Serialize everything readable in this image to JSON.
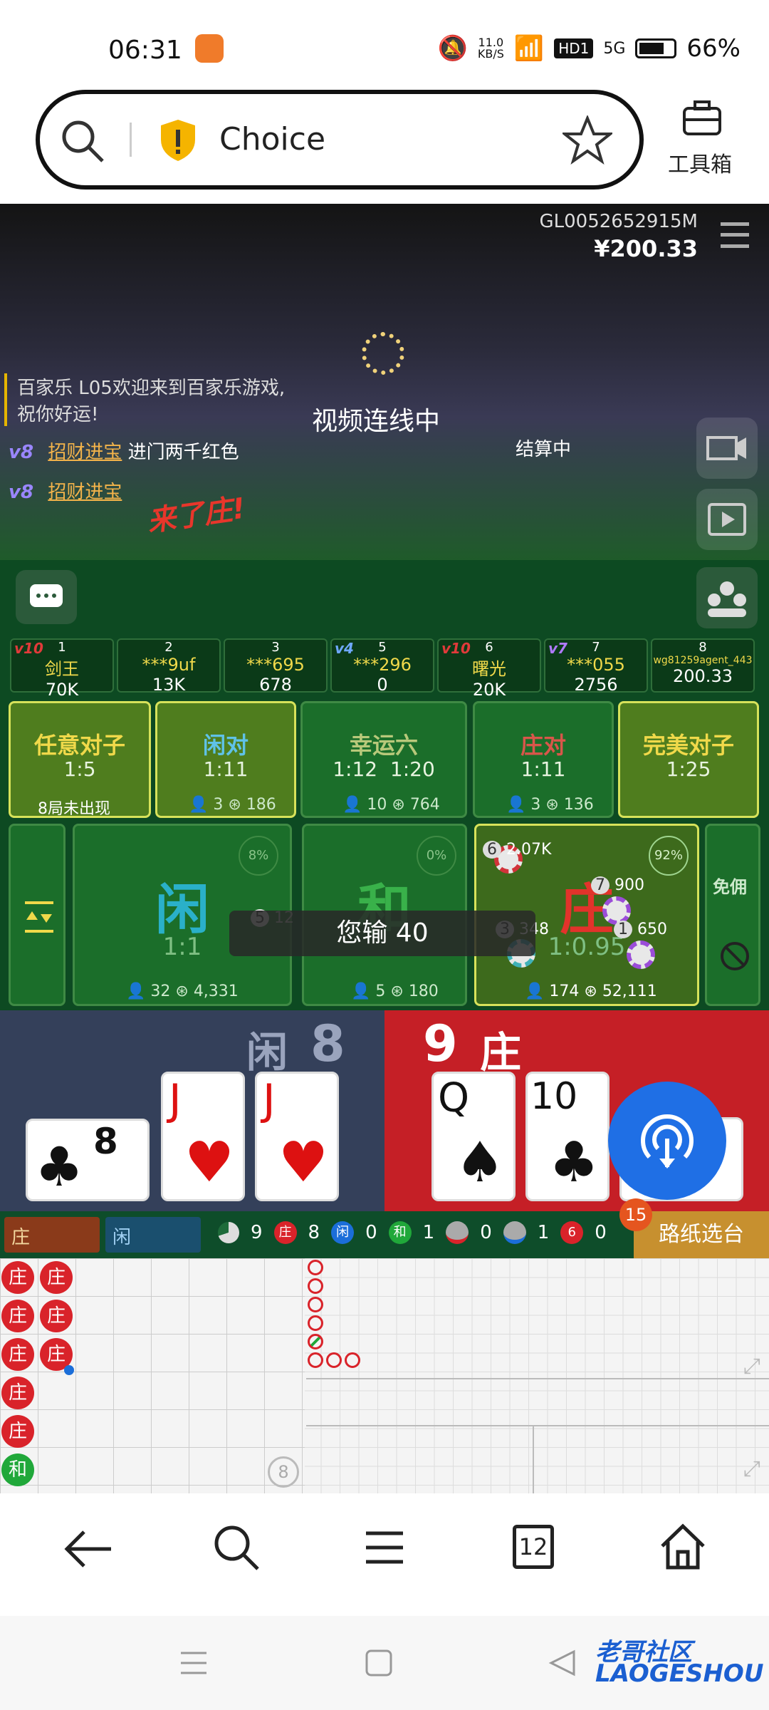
{
  "status": {
    "time": "06:31",
    "speed": "11.0\nKB/S",
    "hd": "HD1",
    "net": "5G",
    "battery": "66%"
  },
  "browser": {
    "site_name": "Choice",
    "toolbox_label": "工具箱"
  },
  "game": {
    "account_id": "GL0052652915M",
    "balance": "¥200.33",
    "video_status": "视频连线中",
    "settle_status": "结算中",
    "chat": [
      {
        "text": "百家乐 L05欢迎来到百家乐游戏,\n祝你好运!"
      },
      {
        "vip": "v8",
        "name": "招财进宝",
        "text": " 进门两千红色"
      },
      {
        "vip": "v8",
        "name": "招财进宝",
        "text": ""
      }
    ],
    "banner_text": "来了庄!",
    "seats": [
      {
        "vip": "v10",
        "num": "1",
        "name": "剑王",
        "amount": "70K"
      },
      {
        "vip": "",
        "num": "2",
        "name": "***9uf",
        "amount": "13K"
      },
      {
        "vip": "",
        "num": "3",
        "name": "***695",
        "amount": "678"
      },
      {
        "vip": "v4",
        "num": "5",
        "name": "***296",
        "amount": "0"
      },
      {
        "vip": "v10",
        "num": "6",
        "name": "曙光",
        "amount": "20K"
      },
      {
        "vip": "v7",
        "num": "7",
        "name": "***055",
        "amount": "2756"
      },
      {
        "vip": "",
        "num": "8",
        "name": "wg81259agent_443",
        "amount": "200.33"
      }
    ],
    "side_bets": [
      {
        "title": "任意对子",
        "odds": "1:5",
        "note": "8局未出现",
        "players": "",
        "chips": ""
      },
      {
        "title": "闲对",
        "odds": "1:11",
        "note": "",
        "players": "3",
        "chips": "186"
      },
      {
        "title": "幸运六",
        "odds": "1:12  1:20",
        "note": "",
        "players": "10",
        "chips": "764"
      },
      {
        "title": "庄对",
        "odds": "1:11",
        "note": "",
        "players": "3",
        "chips": "136"
      },
      {
        "title": "完美对子",
        "odds": "1:25",
        "note": "",
        "players": "",
        "chips": ""
      }
    ],
    "main_bets": [
      {
        "title": "闲",
        "odds": "1:1",
        "pct": "8%",
        "players": "32",
        "chips": "4,331"
      },
      {
        "title": "和",
        "odds": "",
        "pct": "0%",
        "players": "5",
        "chips": "180"
      },
      {
        "title": "庄",
        "odds": "1:0.95",
        "pct": "92%",
        "players": "174",
        "chips": "52,111"
      }
    ],
    "commission_label": "免佣",
    "result_text": "您输 40",
    "chip_labels": [
      {
        "num": "6",
        "amount": "2.07K"
      },
      {
        "num": "7",
        "amount": "900"
      },
      {
        "num": "3",
        "amount": "348"
      },
      {
        "num": "1",
        "amount": "650"
      },
      {
        "num": "5",
        "amount": "12"
      }
    ],
    "player_score": {
      "label": "闲",
      "score": "8"
    },
    "banker_score": {
      "label": "庄",
      "score": "9"
    },
    "player_cards": [
      "J",
      "J"
    ],
    "banker_cards": [
      "Q",
      "10"
    ],
    "road": {
      "banker_tab": "庄",
      "player_tab": "闲",
      "stats": [
        {
          "icon": "pie",
          "value": "9"
        },
        {
          "icon": "庄",
          "value": "8"
        },
        {
          "icon": "闲",
          "value": "0"
        },
        {
          "icon": "和",
          "value": "1"
        },
        {
          "icon": "red-dot",
          "value": "0"
        },
        {
          "icon": "blue-dot",
          "value": "1"
        },
        {
          "icon": "6",
          "value": "0"
        }
      ],
      "picker": "路纸选台",
      "badge": "15"
    },
    "bead_cells": [
      "庄",
      "庄",
      "庄",
      "庄",
      "庄",
      "庄",
      "庄",
      "庄",
      "和"
    ],
    "road_round_label": "8"
  },
  "nav": {
    "tab_count": "12"
  },
  "watermark": "老哥社区\nLAOGESHOU"
}
